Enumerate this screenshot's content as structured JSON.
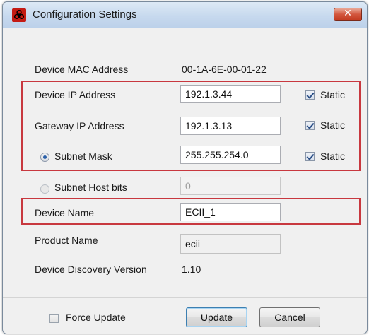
{
  "window": {
    "title": "Configuration Settings",
    "icons": {
      "app": "biohazard-icon",
      "close": "close-icon"
    },
    "close_glyph": "✕"
  },
  "fields": {
    "device_mac_label": "Device MAC Address",
    "device_mac_value": "00-1A-6E-00-01-22",
    "device_ip_label": "Device IP Address",
    "device_ip_value": "192.1.3.44",
    "gateway_ip_label": "Gateway IP Address",
    "gateway_ip_value": "192.1.3.13",
    "subnet_mask_label": "Subnet Mask",
    "subnet_mask_value": "255.255.254.0",
    "subnet_host_bits_label": "Subnet Host bits",
    "subnet_host_bits_value": "0",
    "device_name_label": "Device Name",
    "device_name_value": "ECII_1",
    "product_name_label": "Product Name",
    "product_name_value": "ecii",
    "discovery_version_label": "Device Discovery Version",
    "discovery_version_value": "1.10"
  },
  "static_label": "Static",
  "static_checkboxes": {
    "device_ip": true,
    "gateway_ip": true,
    "subnet_mask": true
  },
  "subnet_mode": "subnet-mask",
  "footer": {
    "force_update_label": "Force Update",
    "force_update_checked": false,
    "update_label": "Update",
    "cancel_label": "Cancel"
  },
  "colors": {
    "highlight_border": "#c8383f",
    "app_icon": "#c41b14",
    "close_button": "#c9452b"
  }
}
